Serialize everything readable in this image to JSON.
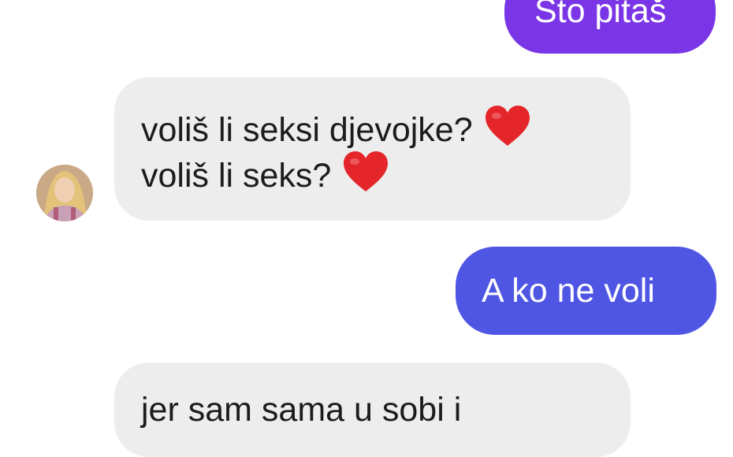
{
  "messages": {
    "m1": {
      "text": "Što pitaš"
    },
    "m2": {
      "line1": "voliš li seksi djevojke?",
      "line2": "voliš li seks?",
      "emoji": "heart-emoji"
    },
    "m3": {
      "text": "A ko ne voli"
    },
    "m4": {
      "text": "jer sam sama u sobi i"
    }
  },
  "colors": {
    "outgoing_purple": "#7a35e6",
    "outgoing_blue": "#4f56e3",
    "incoming_gray": "#ededed",
    "heart_red": "#e4262b"
  }
}
